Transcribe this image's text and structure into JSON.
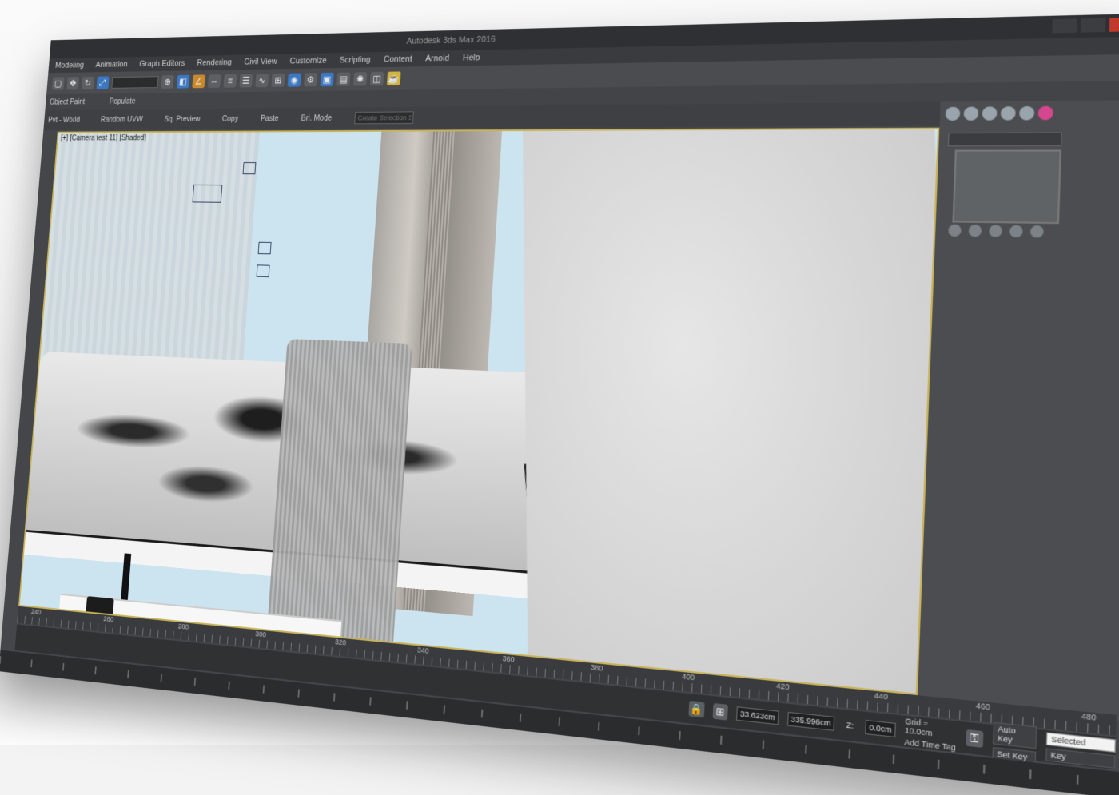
{
  "window": {
    "title": "Autodesk 3ds Max 2016"
  },
  "menus": [
    "Modeling",
    "Animation",
    "Graph Editors",
    "Rendering",
    "Civil View",
    "Customize",
    "Scripting",
    "Content",
    "Arnold",
    "Help"
  ],
  "toolbar2": {
    "items": [
      "Object Paint",
      "Populate"
    ]
  },
  "toolbar3": {
    "items": [
      "Pvt - World",
      "Random UVW",
      "Sq. Preview",
      "Copy",
      "Paste",
      "Bri. Mode"
    ],
    "selection_set_placeholder": "Create Selection Se"
  },
  "viewport": {
    "label": "[+] [Camera test 11] [Shaded]"
  },
  "timeline": {
    "ticks": [
      "240",
      "260",
      "280",
      "300",
      "320",
      "340",
      "360",
      "380",
      "400",
      "420",
      "440",
      "460",
      "480"
    ]
  },
  "status": {
    "x_value": "33.623cm",
    "y_value": "335.996cm",
    "z_label": "Z:",
    "z_value": "0.0cm",
    "grid": "Grid = 10.0cm",
    "add_time_tag": "Add Time Tag",
    "auto_key": "Auto Key",
    "set_key": "Set Key",
    "key_mode": "Selected",
    "key_filters": "Key"
  },
  "colors": {
    "accent_viewport_border": "#c8b25a",
    "ui_background": "#444649",
    "command_panel_accent": "#d4478f"
  },
  "icons": [
    "select-icon",
    "move-icon",
    "rotate-icon",
    "scale-icon",
    "snap-icon",
    "render-icon",
    "light-icon",
    "camera-icon",
    "key-icon",
    "time-tag-icon"
  ]
}
